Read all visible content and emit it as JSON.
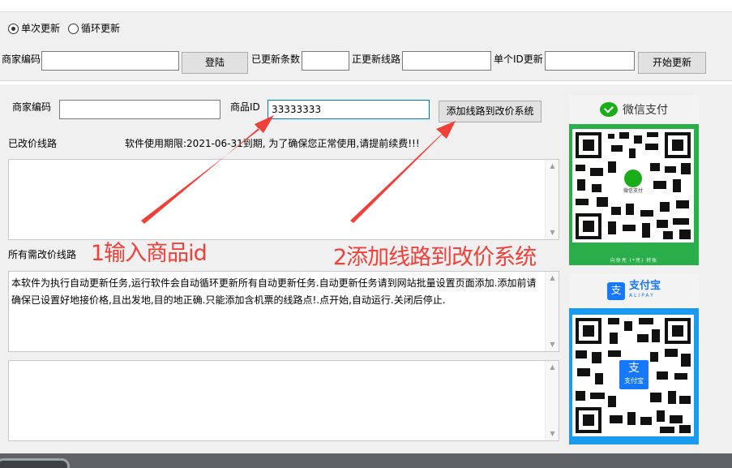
{
  "mode_radios": [
    {
      "label": "单次更新",
      "checked": true
    },
    {
      "label": "循环更新",
      "checked": false
    }
  ],
  "top_form": {
    "merchant_label": "商家编码",
    "merchant_value": "",
    "login_button": "登陆",
    "updated_count_label": "已更新条数",
    "updated_count_value": "",
    "updating_route_label": "正更新线路",
    "updating_route_value": "",
    "single_id_label": "单个ID更新",
    "single_id_value": "",
    "start_button": "开始更新"
  },
  "main_form": {
    "merchant_label": "商家编码",
    "merchant_value": "",
    "product_id_label": "商品ID",
    "product_id_value": "33333333",
    "add_route_button": "添加线路到改价系统",
    "changed_routes_label": "已改价线路",
    "expiry_notice": "软件使用期限:2021-06-31到期,   为了确保您正常使用,请提前续费!!!",
    "all_routes_label": "所有需改价线路",
    "description": "本软件为执行自动更新任务,运行软件会自动循环更新所有自动更新任务.自动更新任务请到网站批量设置页面添加.添加前请确保已设置好地接价格,且出发地,目的地正确.只能添加含机票的线路点!.点开始,自动运行.关闭后停止."
  },
  "annotations": {
    "step1": "1输入商品id",
    "step2": "2添加线路到改价系统",
    "color": "#f0403a"
  },
  "payments": {
    "wechat_title": "微信支付",
    "wechat_center": "微信支付",
    "wechat_footer": "向徐亮 (*亮) 转账",
    "alipay_title": "支付宝",
    "alipay_subtitle": "ALIPAY",
    "alipay_center": "支付宝",
    "wechat_color": "#2aae49",
    "alipay_color": "#1a9bf0"
  }
}
